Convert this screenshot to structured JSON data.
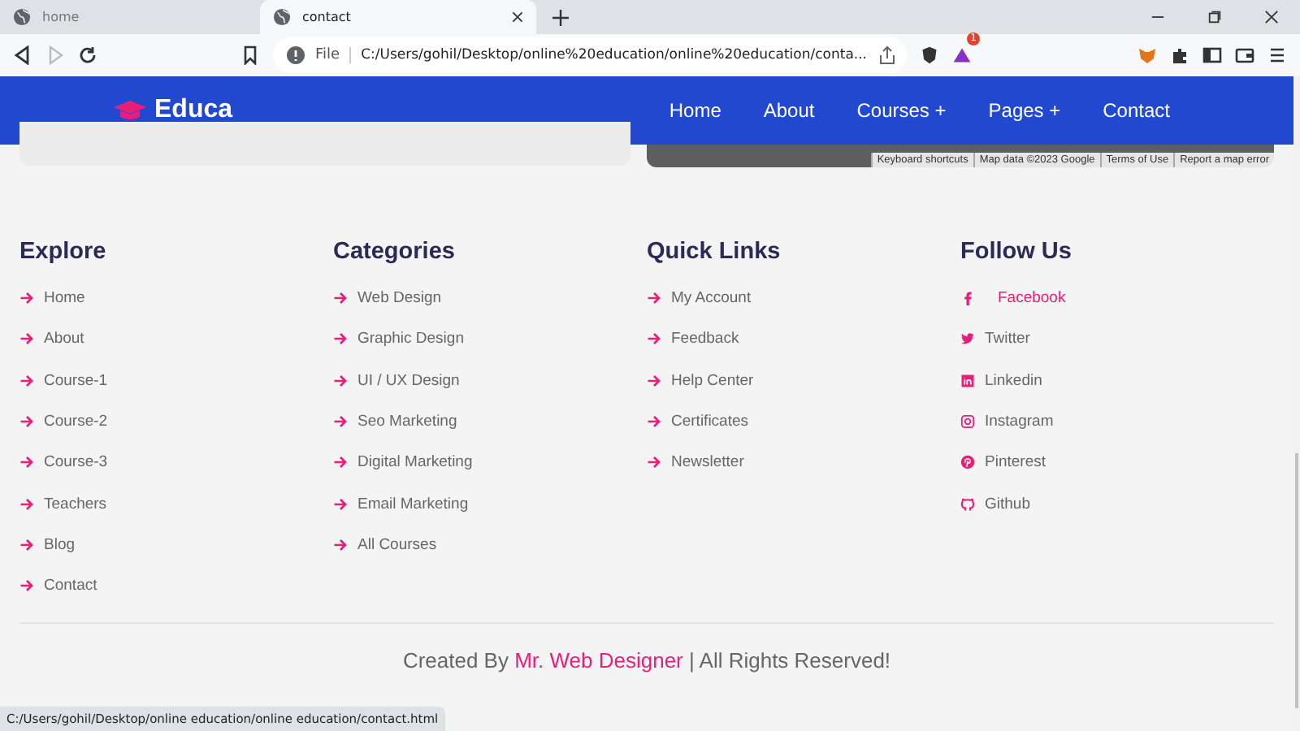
{
  "browser": {
    "tabs": [
      {
        "title": "home",
        "selected": false
      },
      {
        "title": "contact",
        "selected": true
      }
    ],
    "address": {
      "scheme": "File",
      "url": "C:/Users/gohil/Desktop/online%20education/online%20education/conta..."
    },
    "badge_count": "1"
  },
  "navbar": {
    "logo": "Educa",
    "links": [
      "Home",
      "About",
      "Courses +",
      "Pages +",
      "Contact"
    ]
  },
  "map": {
    "attribution": [
      "Keyboard shortcuts",
      "Map data ©2023 Google",
      "Terms of Use",
      "Report a map error"
    ]
  },
  "footer": {
    "columns": [
      {
        "heading": "Explore",
        "kind": "links",
        "items": [
          {
            "label": "Home",
            "highlighted": false
          },
          {
            "label": "About",
            "highlighted": false
          },
          {
            "label": "Course-1",
            "highlighted": false
          },
          {
            "label": "Course-2",
            "highlighted": false
          },
          {
            "label": "Course-3",
            "highlighted": false
          },
          {
            "label": "Teachers",
            "highlighted": false
          },
          {
            "label": "Blog",
            "highlighted": false
          },
          {
            "label": "Contact",
            "highlighted": false
          }
        ]
      },
      {
        "heading": "Categories",
        "kind": "links",
        "items": [
          {
            "label": "Web Design",
            "highlighted": false
          },
          {
            "label": "Graphic Design",
            "highlighted": false
          },
          {
            "label": "UI / UX Design",
            "highlighted": false
          },
          {
            "label": "Seo Marketing",
            "highlighted": false
          },
          {
            "label": "Digital Marketing",
            "highlighted": false
          },
          {
            "label": "Email Marketing",
            "highlighted": false
          },
          {
            "label": "All Courses",
            "highlighted": false
          }
        ]
      },
      {
        "heading": "Quick Links",
        "kind": "links",
        "items": [
          {
            "label": "My Account",
            "highlighted": false
          },
          {
            "label": "Feedback",
            "highlighted": false
          },
          {
            "label": "Help Center",
            "highlighted": false
          },
          {
            "label": "Certificates",
            "highlighted": false
          },
          {
            "label": "Newsletter",
            "highlighted": false
          }
        ]
      },
      {
        "heading": "Follow Us",
        "kind": "social",
        "items": [
          {
            "label": "Facebook",
            "highlighted": true
          },
          {
            "label": "Twitter",
            "highlighted": false
          },
          {
            "label": "Linkedin",
            "highlighted": false
          },
          {
            "label": "Instagram",
            "highlighted": false
          },
          {
            "label": "Pinterest",
            "highlighted": false
          },
          {
            "label": "Github",
            "highlighted": false
          }
        ]
      }
    ],
    "credit": "Created By **Mr. Web Designer** | All Rights Reserved!"
  },
  "status_url": "C:/Users/gohil/Desktop/online education/online education/contact.html"
}
